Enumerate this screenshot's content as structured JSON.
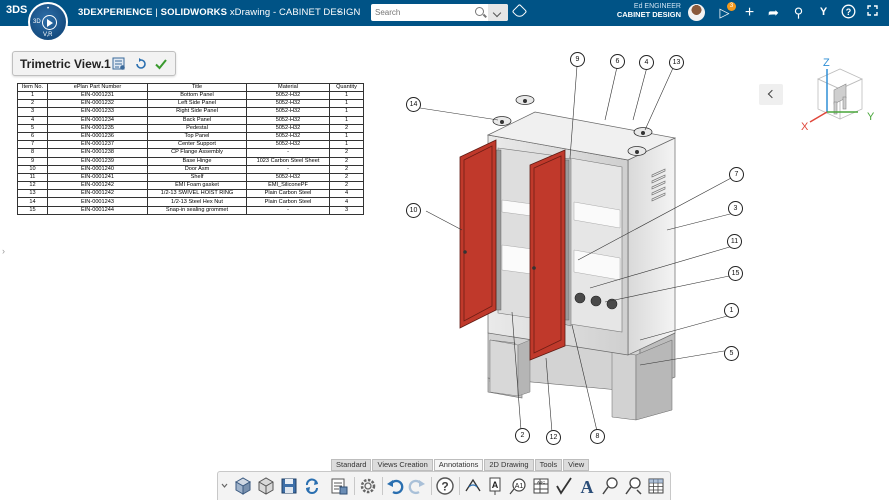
{
  "header": {
    "brand_logo": "3DS",
    "app_platform": "3DEXPERIENCE",
    "app_separator": " | ",
    "app_product": "SOLIDWORKS",
    "app_title": " xDrawing - CABINET DESIGN",
    "compass_label": "V,R",
    "compass_3d": "3D",
    "search_placeholder": "Search",
    "user_name": "Ed ENGINEER",
    "user_context": "CABINET DESIGN",
    "notification_count": "3",
    "accent_color": "#005386"
  },
  "view": {
    "title": "Trimetric View.1"
  },
  "bom": {
    "columns": [
      "Item No.",
      "ePlan Part Number",
      "Title",
      "Material",
      "Quantity"
    ],
    "rows": [
      [
        "1",
        "EIN-0001231",
        "Bottom Panel",
        "5052-H32",
        "1"
      ],
      [
        "2",
        "EIN-0001232",
        "Left Side Panel",
        "5052-H32",
        "1"
      ],
      [
        "3",
        "EIN-0001233",
        "Right Side Panel",
        "5052-H32",
        "1"
      ],
      [
        "4",
        "EIN-0001234",
        "Back Panel",
        "5052-H32",
        "1"
      ],
      [
        "5",
        "EIN-0001235",
        "Pedestal",
        "5052-H32",
        "2"
      ],
      [
        "6",
        "EIN-0001236",
        "Top Panel",
        "5052-H32",
        "1"
      ],
      [
        "7",
        "EIN-0001237",
        "Center Support",
        "5052-H32",
        "1"
      ],
      [
        "8",
        "EIN-0001238",
        "CP Flange Assembly",
        "-",
        "2"
      ],
      [
        "9",
        "EIN-0001239",
        "Base Hinge",
        "1023 Carbon Steel Sheet",
        "2"
      ],
      [
        "10",
        "EIN-0001240",
        "Door Asm",
        "-",
        "2"
      ],
      [
        "11",
        "EIN-0001241",
        "Shelf",
        "5052-H32",
        "2"
      ],
      [
        "12",
        "EIN-0001242",
        "EMI Foam gasket",
        "EMI_SiliconePF",
        "2"
      ],
      [
        "13",
        "EIN-0001242",
        "1/2-13 SWIVEL HOIST RING",
        "Plain Carbon Steel",
        "4"
      ],
      [
        "14",
        "EIN-0001243",
        "1/2-13 Steel Hex Nut",
        "Plain Carbon Steel",
        "4"
      ],
      [
        "15",
        "EIN-0001244",
        "Snap-in sealing grommet",
        "-",
        "3"
      ]
    ]
  },
  "balloons": {
    "b1": "1",
    "b2": "2",
    "b3": "3",
    "b4": "4",
    "b5": "5",
    "b6": "6",
    "b7": "7",
    "b8": "8",
    "b9": "9",
    "b10": "10",
    "b11": "11",
    "b12": "12",
    "b13": "13",
    "b14": "14",
    "b15": "15"
  },
  "viewcube": {
    "x_label": "X",
    "y_label": "Y",
    "z_label": "Z",
    "x_color": "#e0463a",
    "y_color": "#49a63a",
    "z_color": "#2f8fd6"
  },
  "tabs": [
    {
      "label": "Standard"
    },
    {
      "label": "Views Creation"
    },
    {
      "label": "Annotations"
    },
    {
      "label": "2D Drawing"
    },
    {
      "label": "Tools"
    },
    {
      "label": "View"
    }
  ],
  "door_color": "#c0392b"
}
